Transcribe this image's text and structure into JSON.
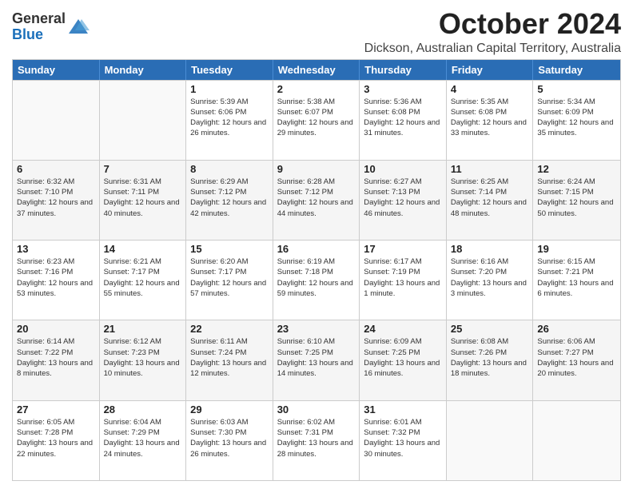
{
  "header": {
    "logo_general": "General",
    "logo_blue": "Blue",
    "month_title": "October 2024",
    "location": "Dickson, Australian Capital Territory, Australia"
  },
  "days_of_week": [
    "Sunday",
    "Monday",
    "Tuesday",
    "Wednesday",
    "Thursday",
    "Friday",
    "Saturday"
  ],
  "rows": [
    [
      {
        "day": "",
        "info": ""
      },
      {
        "day": "",
        "info": ""
      },
      {
        "day": "1",
        "info": "Sunrise: 5:39 AM\nSunset: 6:06 PM\nDaylight: 12 hours\nand 26 minutes."
      },
      {
        "day": "2",
        "info": "Sunrise: 5:38 AM\nSunset: 6:07 PM\nDaylight: 12 hours\nand 29 minutes."
      },
      {
        "day": "3",
        "info": "Sunrise: 5:36 AM\nSunset: 6:08 PM\nDaylight: 12 hours\nand 31 minutes."
      },
      {
        "day": "4",
        "info": "Sunrise: 5:35 AM\nSunset: 6:08 PM\nDaylight: 12 hours\nand 33 minutes."
      },
      {
        "day": "5",
        "info": "Sunrise: 5:34 AM\nSunset: 6:09 PM\nDaylight: 12 hours\nand 35 minutes."
      }
    ],
    [
      {
        "day": "6",
        "info": "Sunrise: 6:32 AM\nSunset: 7:10 PM\nDaylight: 12 hours\nand 37 minutes."
      },
      {
        "day": "7",
        "info": "Sunrise: 6:31 AM\nSunset: 7:11 PM\nDaylight: 12 hours\nand 40 minutes."
      },
      {
        "day": "8",
        "info": "Sunrise: 6:29 AM\nSunset: 7:12 PM\nDaylight: 12 hours\nand 42 minutes."
      },
      {
        "day": "9",
        "info": "Sunrise: 6:28 AM\nSunset: 7:12 PM\nDaylight: 12 hours\nand 44 minutes."
      },
      {
        "day": "10",
        "info": "Sunrise: 6:27 AM\nSunset: 7:13 PM\nDaylight: 12 hours\nand 46 minutes."
      },
      {
        "day": "11",
        "info": "Sunrise: 6:25 AM\nSunset: 7:14 PM\nDaylight: 12 hours\nand 48 minutes."
      },
      {
        "day": "12",
        "info": "Sunrise: 6:24 AM\nSunset: 7:15 PM\nDaylight: 12 hours\nand 50 minutes."
      }
    ],
    [
      {
        "day": "13",
        "info": "Sunrise: 6:23 AM\nSunset: 7:16 PM\nDaylight: 12 hours\nand 53 minutes."
      },
      {
        "day": "14",
        "info": "Sunrise: 6:21 AM\nSunset: 7:17 PM\nDaylight: 12 hours\nand 55 minutes."
      },
      {
        "day": "15",
        "info": "Sunrise: 6:20 AM\nSunset: 7:17 PM\nDaylight: 12 hours\nand 57 minutes."
      },
      {
        "day": "16",
        "info": "Sunrise: 6:19 AM\nSunset: 7:18 PM\nDaylight: 12 hours\nand 59 minutes."
      },
      {
        "day": "17",
        "info": "Sunrise: 6:17 AM\nSunset: 7:19 PM\nDaylight: 13 hours\nand 1 minute."
      },
      {
        "day": "18",
        "info": "Sunrise: 6:16 AM\nSunset: 7:20 PM\nDaylight: 13 hours\nand 3 minutes."
      },
      {
        "day": "19",
        "info": "Sunrise: 6:15 AM\nSunset: 7:21 PM\nDaylight: 13 hours\nand 6 minutes."
      }
    ],
    [
      {
        "day": "20",
        "info": "Sunrise: 6:14 AM\nSunset: 7:22 PM\nDaylight: 13 hours\nand 8 minutes."
      },
      {
        "day": "21",
        "info": "Sunrise: 6:12 AM\nSunset: 7:23 PM\nDaylight: 13 hours\nand 10 minutes."
      },
      {
        "day": "22",
        "info": "Sunrise: 6:11 AM\nSunset: 7:24 PM\nDaylight: 13 hours\nand 12 minutes."
      },
      {
        "day": "23",
        "info": "Sunrise: 6:10 AM\nSunset: 7:25 PM\nDaylight: 13 hours\nand 14 minutes."
      },
      {
        "day": "24",
        "info": "Sunrise: 6:09 AM\nSunset: 7:25 PM\nDaylight: 13 hours\nand 16 minutes."
      },
      {
        "day": "25",
        "info": "Sunrise: 6:08 AM\nSunset: 7:26 PM\nDaylight: 13 hours\nand 18 minutes."
      },
      {
        "day": "26",
        "info": "Sunrise: 6:06 AM\nSunset: 7:27 PM\nDaylight: 13 hours\nand 20 minutes."
      }
    ],
    [
      {
        "day": "27",
        "info": "Sunrise: 6:05 AM\nSunset: 7:28 PM\nDaylight: 13 hours\nand 22 minutes."
      },
      {
        "day": "28",
        "info": "Sunrise: 6:04 AM\nSunset: 7:29 PM\nDaylight: 13 hours\nand 24 minutes."
      },
      {
        "day": "29",
        "info": "Sunrise: 6:03 AM\nSunset: 7:30 PM\nDaylight: 13 hours\nand 26 minutes."
      },
      {
        "day": "30",
        "info": "Sunrise: 6:02 AM\nSunset: 7:31 PM\nDaylight: 13 hours\nand 28 minutes."
      },
      {
        "day": "31",
        "info": "Sunrise: 6:01 AM\nSunset: 7:32 PM\nDaylight: 13 hours\nand 30 minutes."
      },
      {
        "day": "",
        "info": ""
      },
      {
        "day": "",
        "info": ""
      }
    ]
  ]
}
